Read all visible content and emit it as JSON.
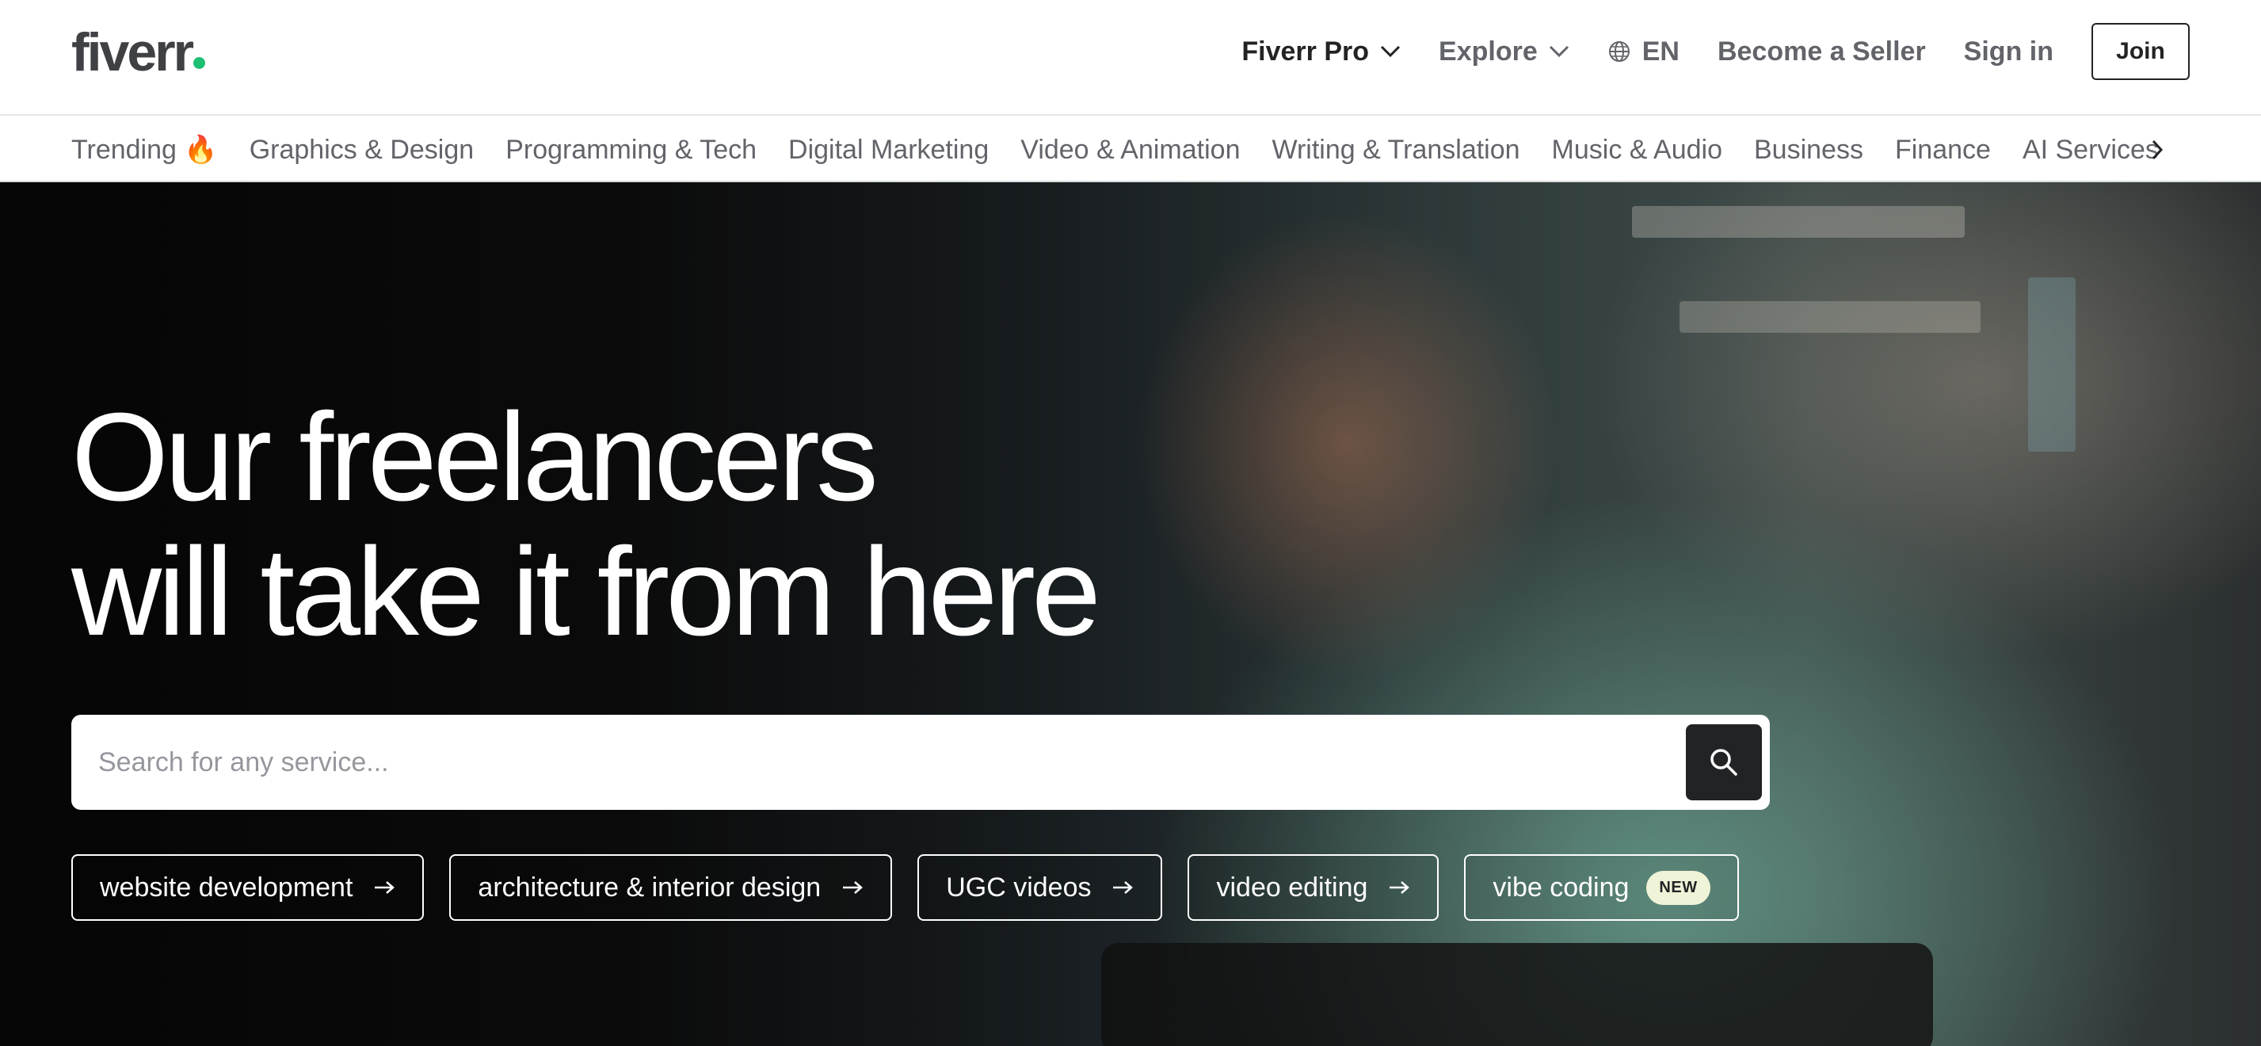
{
  "header": {
    "logo_text": "fiverr",
    "nav": {
      "fiverr_pro": "Fiverr Pro",
      "explore": "Explore",
      "language": "EN",
      "become_seller": "Become a Seller",
      "sign_in": "Sign in",
      "join": "Join"
    }
  },
  "categories": [
    "Trending 🔥",
    "Graphics & Design",
    "Programming & Tech",
    "Digital Marketing",
    "Video & Animation",
    "Writing & Translation",
    "Music & Audio",
    "Business",
    "Finance",
    "AI Services"
  ],
  "hero": {
    "title_line1": "Our freelancers",
    "title_line2": "will take it from here",
    "search_placeholder": "Search for any service...",
    "chips": [
      {
        "label": "website development"
      },
      {
        "label": "architecture & interior design"
      },
      {
        "label": "UGC videos"
      },
      {
        "label": "video editing"
      },
      {
        "label": "vibe coding",
        "badge": "NEW"
      }
    ]
  },
  "colors": {
    "brand_green": "#1dbf73",
    "text_dark": "#222325",
    "text_muted": "#62646a",
    "badge_bg": "#eff3d8"
  },
  "icons": [
    "chevron-down-icon",
    "globe-icon",
    "chevron-right-icon",
    "search-icon",
    "arrow-right-icon"
  ]
}
